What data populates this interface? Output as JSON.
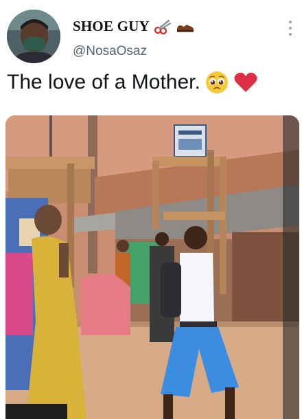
{
  "author": {
    "display_name": "SHOE GUY",
    "handle": "@NosaOsaz",
    "name_emojis": [
      "scissors-icon",
      "shoe-icon"
    ],
    "avatar_icon": "profile-photo-masked-man"
  },
  "tweet": {
    "text": "The love of a Mother.",
    "emojis": [
      "pleading-face-icon",
      "red-heart-icon"
    ]
  },
  "media": {
    "type": "photo",
    "sign_text": "",
    "colors": {
      "wall": "#c8826b",
      "ground": "#d9b08f",
      "chair": "#b8885b",
      "shirt": "#f4f6fa",
      "shorts": "#3b8de0",
      "dress": "#d9b23a"
    }
  },
  "menu": {
    "icon": "more-vertical-icon"
  }
}
